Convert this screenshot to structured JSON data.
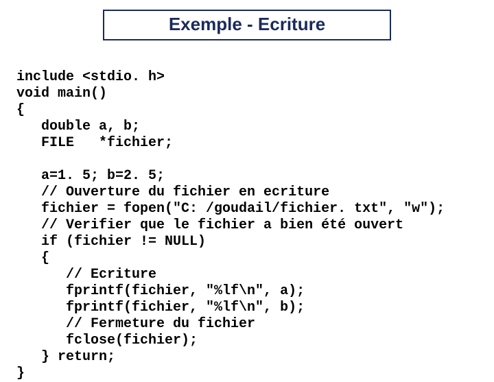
{
  "title": "Exemple - Ecriture",
  "code": {
    "l01": "include <stdio. h>",
    "l02": "void main()",
    "l03": "{",
    "l04": "   double a, b;",
    "l05": "   FILE   *fichier;",
    "l06": "",
    "l07": "   a=1. 5; b=2. 5;",
    "l08": "   // Ouverture du fichier en ecriture",
    "l09": "   fichier = fopen(\"C: /goudail/fichier. txt\", \"w\");",
    "l10": "   // Verifier que le fichier a bien été ouvert",
    "l11": "   if (fichier != NULL)",
    "l12": "   {",
    "l13": "      // Ecriture",
    "l14": "      fprintf(fichier, \"%lf\\n\", a);",
    "l15": "      fprintf(fichier, \"%lf\\n\", b);",
    "l16": "      // Fermeture du fichier",
    "l17": "      fclose(fichier);",
    "l18": "   } return;",
    "l19": "}"
  }
}
